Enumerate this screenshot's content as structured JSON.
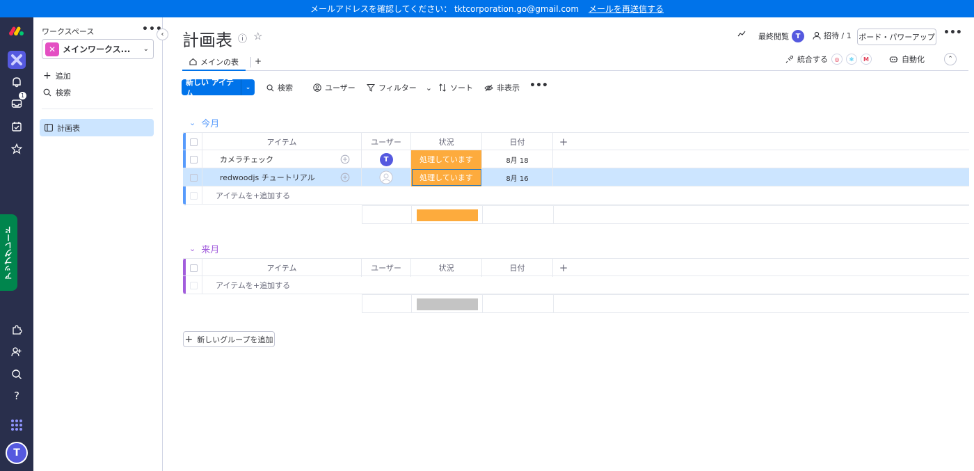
{
  "banner": {
    "message": "メールアドレスを確認してください： tktcorporation.go@gmail.com",
    "link": "メールを再送信する"
  },
  "rail": {
    "inbox_badge": "1",
    "upgrade": "アップグレード",
    "avatar": "T"
  },
  "sidebar": {
    "label": "ワークスペース",
    "workspace_name": "メインワークス...",
    "add": "追加",
    "search": "検索",
    "board": "計画表"
  },
  "header": {
    "title": "計画表",
    "last_seen": "最終閲覧",
    "last_seen_avatar": "T",
    "invite": "招待 / 1",
    "powerup": "ボード・パワーアップ"
  },
  "tabs": {
    "main": "メインの表",
    "add": "+"
  },
  "header_actions": {
    "integrate": "統合する",
    "automate": "自動化"
  },
  "toolbar": {
    "new_item": "新しい アイテム",
    "search": "検索",
    "user": "ユーザー",
    "filter": "フィルター",
    "sort": "ソート",
    "hide": "非表示"
  },
  "columns": {
    "item": "アイテム",
    "user": "ユーザー",
    "status": "状況",
    "date": "日付",
    "add": "+"
  },
  "colors": {
    "group1": "#579bfc",
    "group2": "#a25ddc",
    "status_working": "#fdab3d",
    "status_empty": "#c4c4c4"
  },
  "groups": [
    {
      "name": "今月",
      "items": [
        {
          "name": "カメラチェック",
          "user": "T",
          "status": "処理しています",
          "date": "8月 18"
        },
        {
          "name": "redwoodjs チュートリアル",
          "user": "",
          "status": "処理しています",
          "date": "8月 16"
        }
      ],
      "add_item": "アイテムを+追加する"
    },
    {
      "name": "来月",
      "items": [],
      "add_item": "アイテムを+追加する"
    }
  ],
  "add_group": "新しいグループを追加"
}
